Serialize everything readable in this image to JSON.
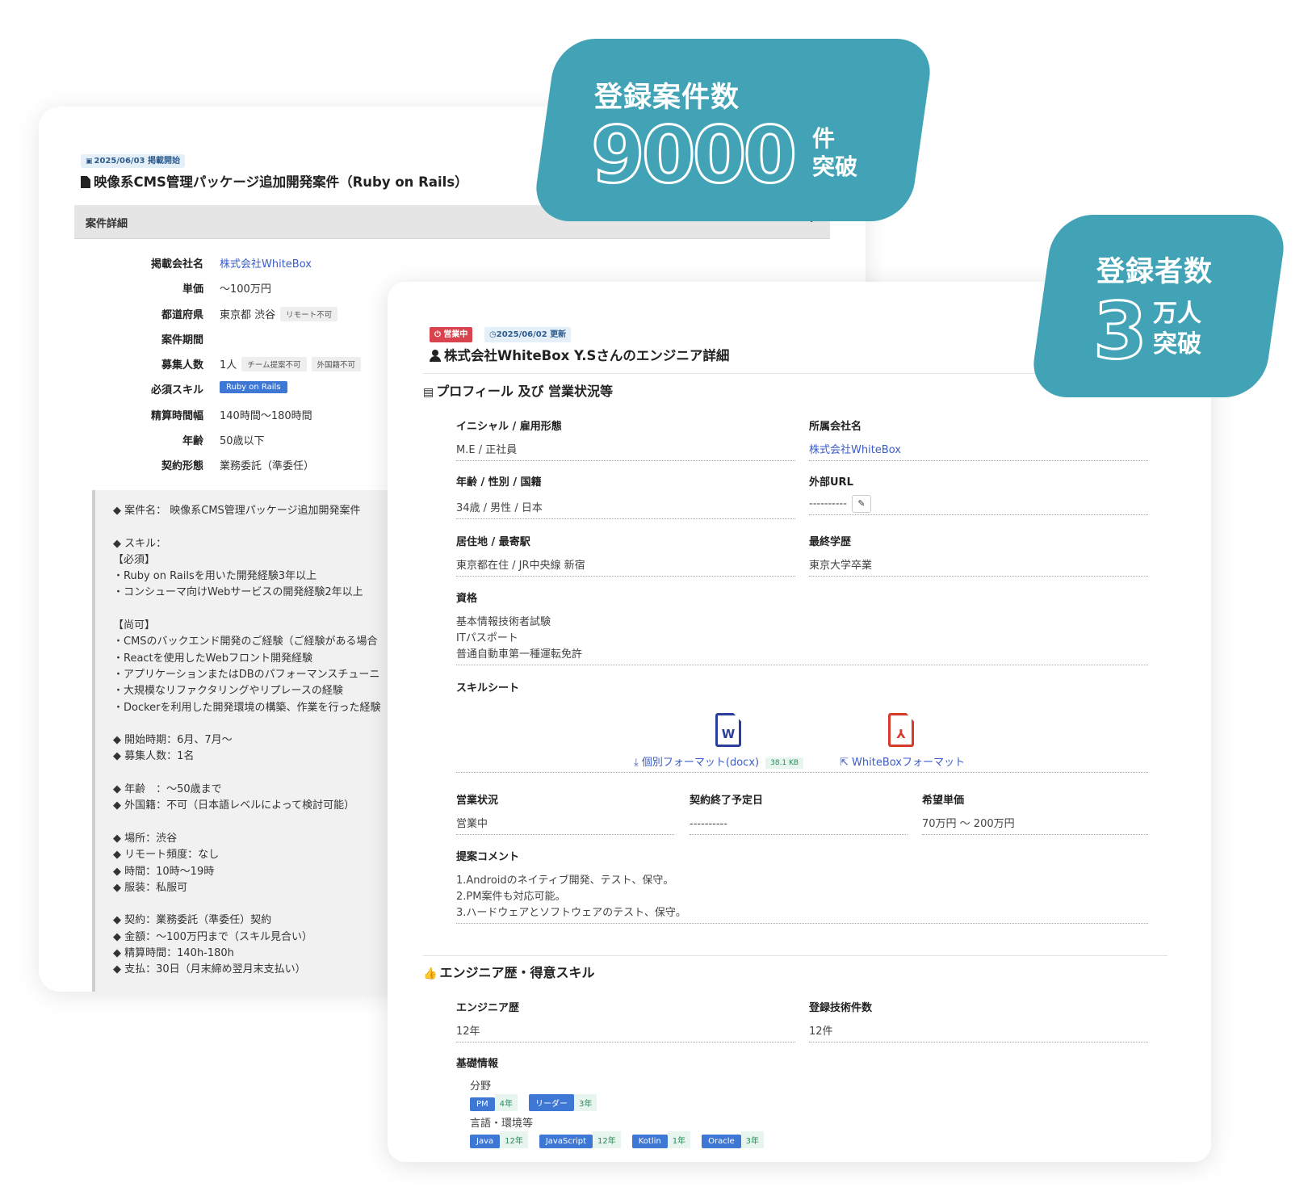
{
  "job": {
    "date_badge": "2025/06/03 掲載開始",
    "title": "映像系CMS管理パッケージ追加開発案件（Ruby on Rails）",
    "detail_header": "案件詳細",
    "rows": [
      {
        "label": "掲載会社名",
        "value": "株式会社WhiteBox"
      },
      {
        "label": "単価",
        "value": "〜100万円"
      },
      {
        "label": "都道府県",
        "value": "東京都 渋谷",
        "tag1": "リモート不可"
      },
      {
        "label": "案件期間",
        "value": ""
      },
      {
        "label": "募集人数",
        "value": "1人",
        "tag1": "チーム提案不可",
        "tag2": "外国籍不可"
      },
      {
        "label": "必須スキル",
        "skill": "Ruby on Rails"
      },
      {
        "label": "精算時間幅",
        "value": "140時間〜180時間"
      },
      {
        "label": "年齢",
        "value": "50歳以下"
      },
      {
        "label": "契約形態",
        "value": "業務委託（準委任）"
      }
    ],
    "description": "◆ 案件名： 映像系CMS管理パッケージ追加開発案件\n\n◆ スキル：\n【必須】\n・Ruby on Railsを用いた開発経験3年以上\n・コンシューマ向けWebサービスの開発経験2年以上\n\n【尚可】\n・CMSのバックエンド開発のご経験（ご経験がある場合\n・Reactを使用したWebフロント開発経験\n・アプリケーションまたはDBのパフォーマンスチューニ\n・大規模なリファクタリングやリプレースの経験\n・Dockerを利用した開発環境の構築、作業を行った経験\n\n◆ 開始時期：6月、7月〜\n◆ 募集人数：1名\n\n◆ 年齢　：〜50歳まで\n◆ 外国籍：不可（日本語レベルによって検討可能）\n\n◆ 場所：渋谷\n◆ リモート頻度：なし\n◆ 時間：10時〜19時\n◆ 服装：私服可\n\n◆ 契約：業務委託（準委任）契約\n◆ 金額：〜100万円まで（スキル見合い）\n◆ 精算時間：140h-180h\n◆ 支払：30日（月末締め翌月末支払い）"
  },
  "engineer": {
    "status_badge": "営業中",
    "updated_badge": "2025/06/02 更新",
    "title": "株式会社WhiteBox Y.Sさんのエンジニア詳細",
    "profile_section": "プロフィール 及び 営業状況等",
    "fields": {
      "initial_label": "イニシャル / 雇用形態",
      "initial_value": "M.E / 正社員",
      "company_label": "所属会社名",
      "company_value": "株式会社WhiteBox",
      "age_label": "年齢 / 性別 / 国籍",
      "age_value": "34歳 / 男性 / 日本",
      "url_label": "外部URL",
      "url_value": "----------",
      "residence_label": "居住地 / 最寄駅",
      "residence_value": "東京都在住 / JR中央線 新宿",
      "edu_label": "最終学歴",
      "edu_value": "東京大学卒業",
      "qual_label": "資格",
      "qual_values": [
        "基本情報技術者試験",
        "ITパスポート",
        "普通自動車第一種運転免許"
      ],
      "skillsheet_label": "スキルシート",
      "docx_link": "個別フォーマット(docx)",
      "docx_size": "38.1 KB",
      "wb_link": "WhiteBoxフォーマット",
      "sales_label": "営業状況",
      "sales_value": "営業中",
      "contract_end_label": "契約終了予定日",
      "contract_end_value": "----------",
      "price_label": "希望単価",
      "price_value": "70万円 〜 200万円",
      "comment_label": "提案コメント",
      "comment_values": [
        "1.Androidのネイティブ開発、テスト、保守。",
        "2.PM案件も対応可能。",
        "3.ハードウェアとソフトウェアのテスト、保守。"
      ]
    },
    "skill_section": "エンジニア歴・得意スキル",
    "career_label": "エンジニア歴",
    "career_value": "12年",
    "tech_count_label": "登録技術件数",
    "tech_count_value": "12件",
    "basic_label": "基礎情報",
    "field_label": "分野",
    "fields_chips": [
      {
        "name": "PM",
        "years": "4年"
      },
      {
        "name": "リーダー",
        "years": "3年"
      }
    ],
    "lang_label": "言語・環境等",
    "lang_chips": [
      {
        "name": "Java",
        "years": "12年"
      },
      {
        "name": "JavaScript",
        "years": "12年"
      },
      {
        "name": "Kotlin",
        "years": "1年"
      },
      {
        "name": "Oracle",
        "years": "3年"
      }
    ]
  },
  "stats": {
    "projects_title": "登録案件数",
    "projects_number": "9000",
    "projects_suffix1": "件",
    "projects_suffix2": "突破",
    "users_title": "登録者数",
    "users_number": "3",
    "users_suffix1": "万人",
    "users_suffix2": "突破",
    "bubble_color": "#43a3b6"
  }
}
